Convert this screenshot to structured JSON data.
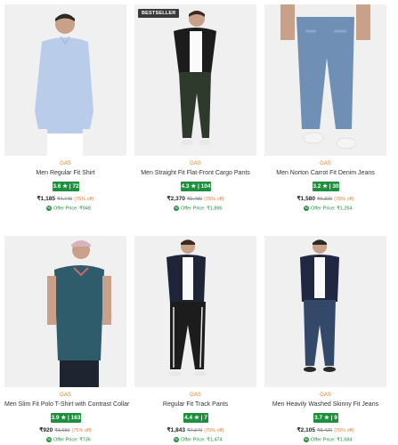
{
  "products": [
    {
      "brand": "GAS",
      "name": "Men Regular Fit Shirt",
      "rating": "3.6 ★ | 72",
      "price": "₹1,185",
      "mrp": "₹4,740",
      "discount": "(75% off)",
      "offer_label": "Offer Price: ₹948",
      "badge": ""
    },
    {
      "brand": "GAS",
      "name": "Men Straight Fit Flat-Front Cargo Pants",
      "rating": "4.3 ★ | 104",
      "price": "₹2,370",
      "mrp": "₹9,480",
      "discount": "(75% off)",
      "offer_label": "Offer Price: ₹1,896",
      "badge": "BESTSELLER"
    },
    {
      "brand": "GAS",
      "name": "Men Norton Carrot Fit Denim Jeans",
      "rating": "3.2 ★ | 30",
      "price": "₹1,580",
      "mrp": "₹6,320",
      "discount": "(75% off)",
      "offer_label": "Offer Price: ₹1,264",
      "badge": ""
    },
    {
      "brand": "GAS",
      "name": "Men Slim Fit Polo T-Shirt with Contrast Collar",
      "rating": "3.9 ★ | 163",
      "price": "₹920",
      "mrp": "₹3,680",
      "discount": "(75% off)",
      "offer_label": "Offer Price: ₹736",
      "badge": ""
    },
    {
      "brand": "GAS",
      "name": "Regular Fit Track Pants",
      "rating": "4.4 ★ | 7",
      "price": "₹1,843",
      "mrp": "₹7,370",
      "discount": "(75% off)",
      "offer_label": "Offer Price: ₹1,474",
      "badge": ""
    },
    {
      "brand": "GAS",
      "name": "Men Heavily Washed Skinny Fit Jeans",
      "rating": "3.7 ★ | 9",
      "price": "₹2,105",
      "mrp": "₹8,420",
      "discount": "(75% off)",
      "offer_label": "Offer Price: ₹1,684",
      "badge": ""
    }
  ],
  "colors": {
    "rating_bg": "#1e8f3c",
    "brand_text": "#d9822b",
    "discount_text": "#e0823a",
    "offer_text": "#1e8f3c"
  },
  "icons": {
    "offer": "offer-tag-icon"
  }
}
